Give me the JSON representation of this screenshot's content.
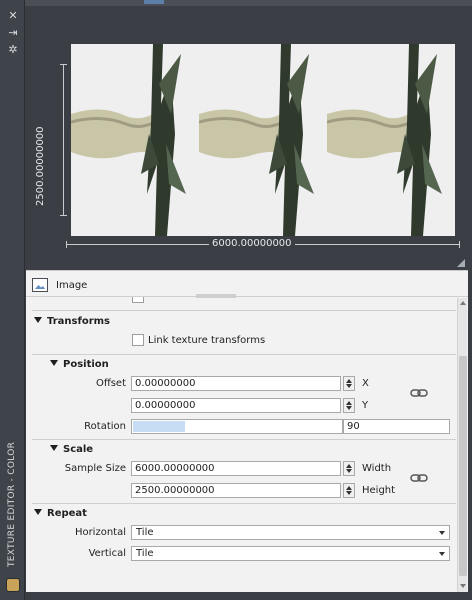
{
  "palette": {
    "chrome": "#3b3f45",
    "panel": "#f2f2f2",
    "accent": "#5b7fa8",
    "slider_fill": "#c6ddf3"
  },
  "side_strip": {
    "icons": [
      "close-icon",
      "collapse-icon",
      "settings-icon"
    ],
    "title": "TEXTURE EDITOR - COLOR"
  },
  "preview": {
    "width_label": "6000.00000000",
    "height_label": "2500.00000000"
  },
  "header": {
    "image_label": "Image"
  },
  "transforms": {
    "title": "Transforms",
    "link_label": "Link texture transforms",
    "link_checked": false
  },
  "position": {
    "title": "Position",
    "offset_label": "Offset",
    "offset_x": "0.00000000",
    "offset_y": "0.00000000",
    "x_label": "X",
    "y_label": "Y",
    "rotation_label": "Rotation",
    "rotation_value": "90",
    "rotation_fraction": 0.25
  },
  "scale": {
    "title": "Scale",
    "sample_size_label": "Sample Size",
    "width_value": "6000.00000000",
    "height_value": "2500.00000000",
    "width_label": "Width",
    "height_label": "Height"
  },
  "repeat": {
    "title": "Repeat",
    "horizontal_label": "Horizontal",
    "horizontal_value": "Tile",
    "vertical_label": "Vertical",
    "vertical_value": "Tile"
  }
}
